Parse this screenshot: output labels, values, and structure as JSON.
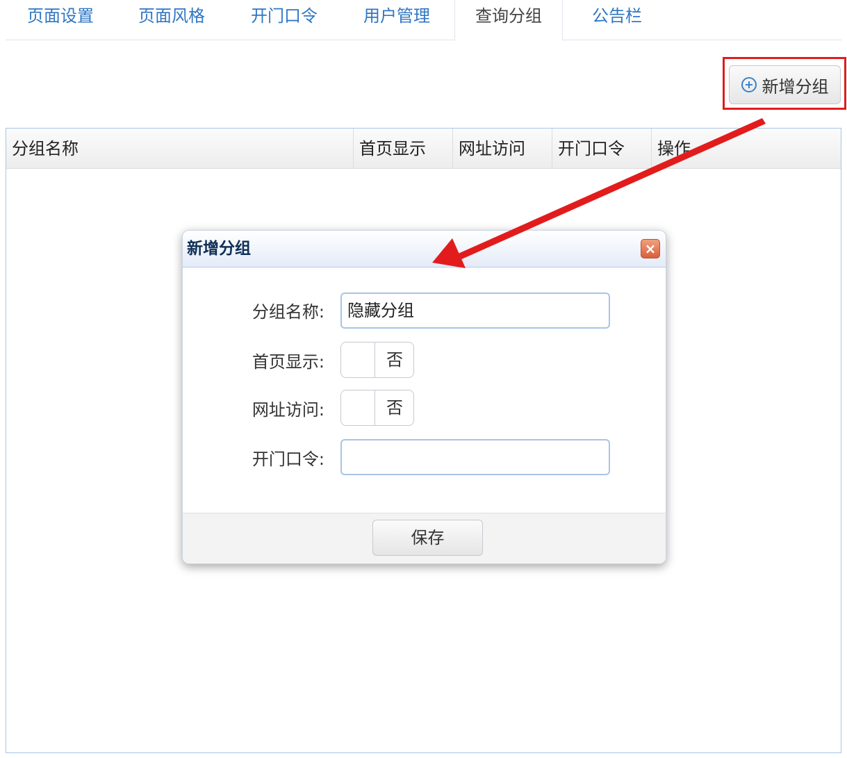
{
  "tabs": [
    "页面设置",
    "页面风格",
    "开门口令",
    "用户管理",
    "查询分组",
    "公告栏"
  ],
  "active_tab_index": 4,
  "toolbar": {
    "add_group_label": "新增分组",
    "add_icon": "plus-circle-icon"
  },
  "grid": {
    "columns": [
      "分组名称",
      "首页显示",
      "网址访问",
      "开门口令",
      "操作"
    ]
  },
  "dialog": {
    "title": "新增分组",
    "close_icon": "close-icon",
    "fields": {
      "group_name": {
        "label": "分组名称:",
        "value": "隐藏分组"
      },
      "home_display": {
        "label": "首页显示:",
        "value": "否"
      },
      "url_access": {
        "label": "网址访问:",
        "value": "否"
      },
      "door_password": {
        "label": "开门口令:",
        "value": ""
      }
    },
    "save_label": "保存"
  },
  "colors": {
    "tab_link": "#2f76c4",
    "highlight": "#e21c1c",
    "arrow": "#e21c1c",
    "border": "#a9c4e6"
  }
}
